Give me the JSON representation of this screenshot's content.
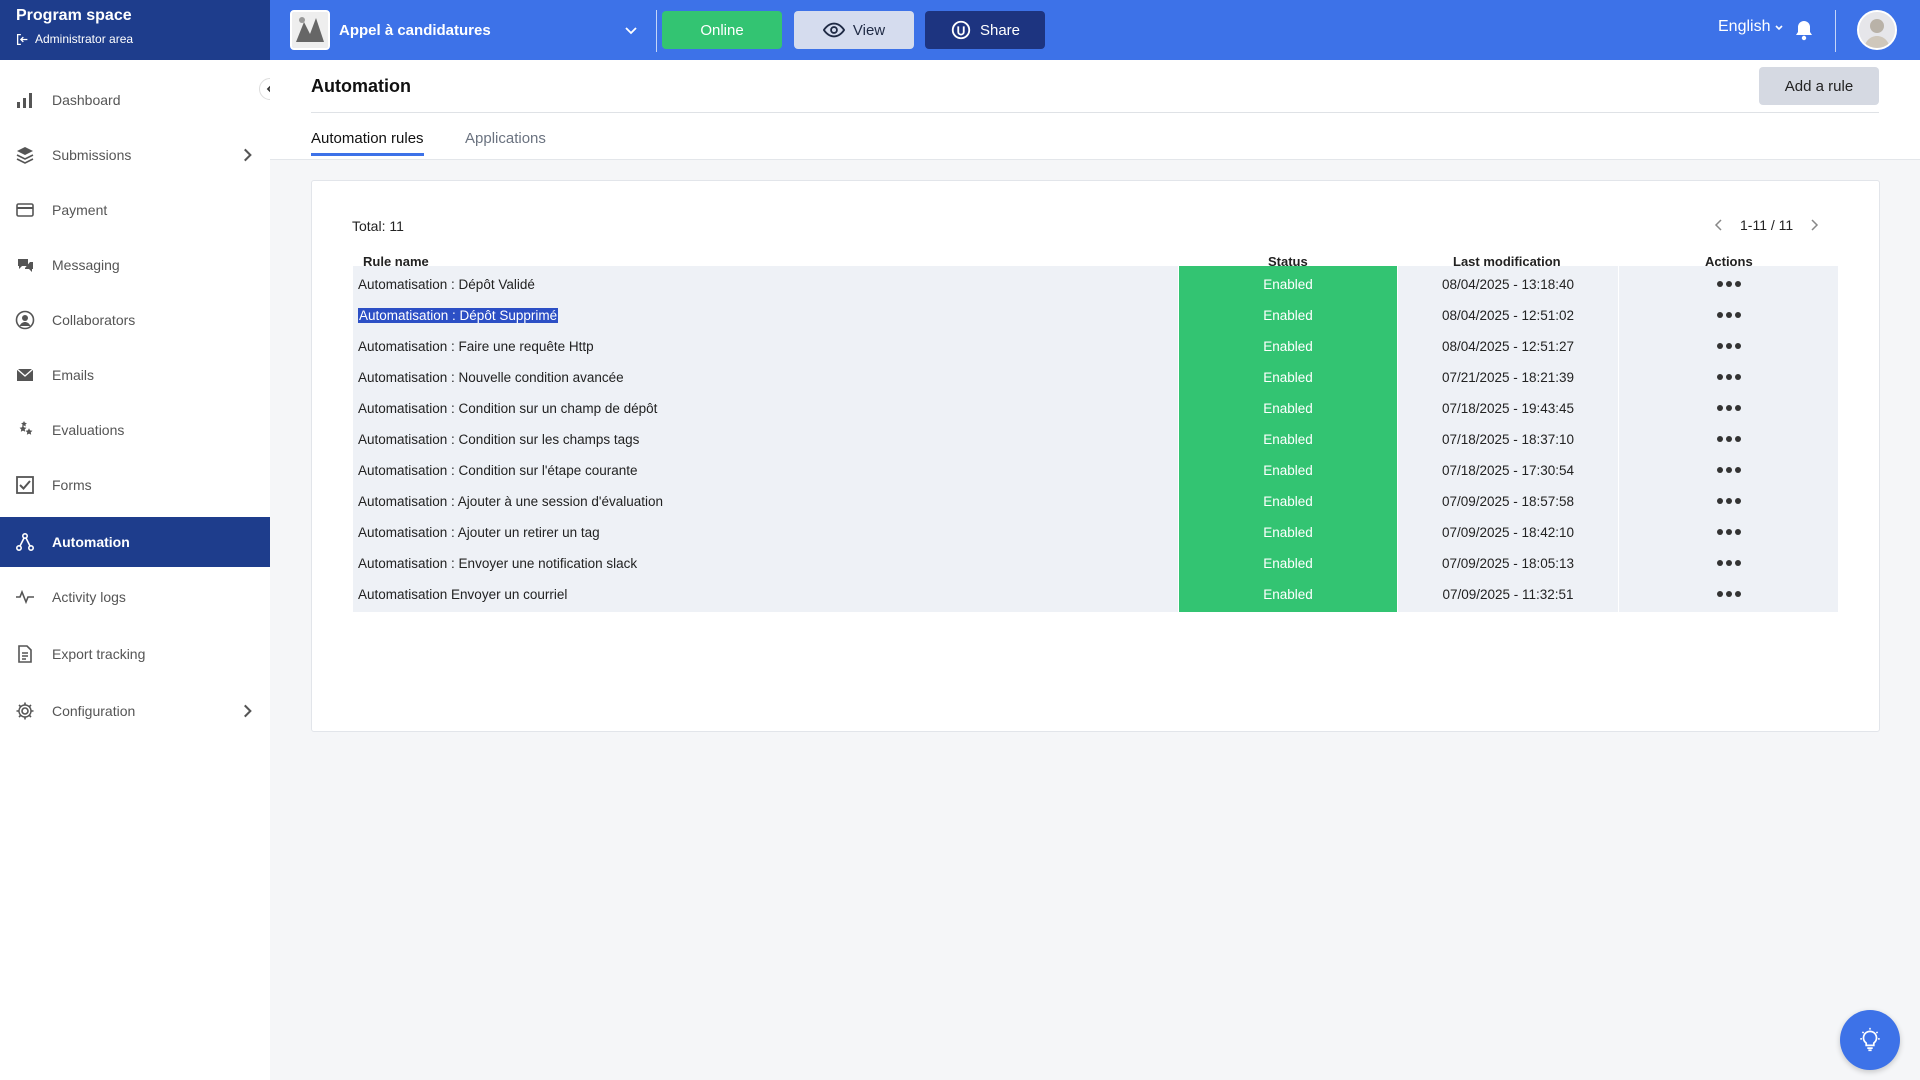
{
  "brand": {
    "title": "Program space",
    "subtitle": "Administrator area"
  },
  "program": {
    "name": "Appel à candidatures"
  },
  "top_buttons": {
    "online": "Online",
    "view": "View",
    "share": "Share"
  },
  "language": "English",
  "sidebar": {
    "items": [
      {
        "label": "Dashboard",
        "icon": "bar-chart-icon"
      },
      {
        "label": "Submissions",
        "icon": "layers-icon"
      },
      {
        "label": "Payment",
        "icon": "credit-card-icon"
      },
      {
        "label": "Messaging",
        "icon": "chat-icon"
      },
      {
        "label": "Collaborators",
        "icon": "user-circle-icon"
      },
      {
        "label": "Emails",
        "icon": "envelope-icon"
      },
      {
        "label": "Evaluations",
        "icon": "stars-icon"
      },
      {
        "label": "Forms",
        "icon": "checkbox-icon"
      },
      {
        "label": "Automation",
        "icon": "automation-icon"
      },
      {
        "label": "Activity logs",
        "icon": "pulse-icon"
      },
      {
        "label": "Export tracking",
        "icon": "document-icon"
      },
      {
        "label": "Configuration",
        "icon": "gear-icon"
      }
    ]
  },
  "page": {
    "title": "Automation",
    "add_button": "Add a rule",
    "tabs": [
      "Automation rules",
      "Applications"
    ]
  },
  "table": {
    "total": "Total: 11",
    "pagination": "1-11 / 11",
    "headers": {
      "name": "Rule name",
      "status": "Status",
      "modified": "Last modification",
      "actions": "Actions"
    },
    "rows": [
      {
        "name": "Automatisation : Dépôt Validé",
        "status": "Enabled",
        "modified": "08/04/2025 - 13:18:40"
      },
      {
        "name": "Automatisation : Dépôt Supprimé",
        "status": "Enabled",
        "modified": "08/04/2025 - 12:51:02"
      },
      {
        "name": "Automatisation : Faire une requête Http",
        "status": "Enabled",
        "modified": "08/04/2025 - 12:51:27"
      },
      {
        "name": "Automatisation : Nouvelle condition avancée",
        "status": "Enabled",
        "modified": "07/21/2025 - 18:21:39"
      },
      {
        "name": "Automatisation : Condition sur un champ de dépôt",
        "status": "Enabled",
        "modified": "07/18/2025 - 19:43:45"
      },
      {
        "name": "Automatisation : Condition sur les champs tags",
        "status": "Enabled",
        "modified": "07/18/2025 - 18:37:10"
      },
      {
        "name": "Automatisation : Condition sur l'étape courante",
        "status": "Enabled",
        "modified": "07/18/2025 - 17:30:54"
      },
      {
        "name": "Automatisation : Ajouter à une session d'évaluation",
        "status": "Enabled",
        "modified": "07/09/2025 - 18:57:58"
      },
      {
        "name": "Automatisation : Ajouter un retirer un tag",
        "status": "Enabled",
        "modified": "07/09/2025 - 18:42:10"
      },
      {
        "name": "Automatisation : Envoyer une notification slack",
        "status": "Enabled",
        "modified": "07/09/2025 - 18:05:13"
      },
      {
        "name": "Automatisation Envoyer un courriel",
        "status": "Enabled",
        "modified": "07/09/2025 - 11:32:51"
      }
    ]
  },
  "colors": {
    "topbar": "#3d72e8",
    "brand": "#1e3d8c",
    "enabled": "#33c472",
    "active_nav": "#1e3d8c"
  }
}
